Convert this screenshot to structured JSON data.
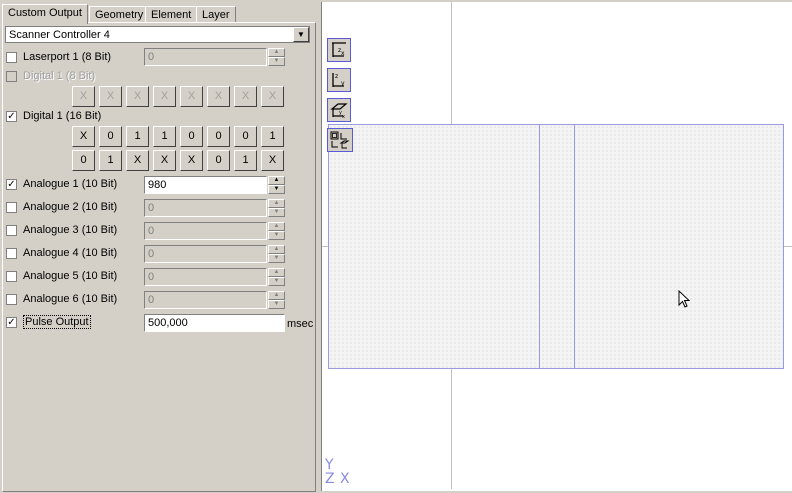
{
  "tabs": [
    "Custom Output",
    "Geometry",
    "Element",
    "Layer"
  ],
  "controller": "Scanner Controller 4",
  "rows": {
    "laserport": {
      "label": "Laserport 1 (8 Bit)",
      "checked": false,
      "value": "0"
    },
    "digital8": {
      "label": "Digital 1 (8 Bit)",
      "checked": false
    },
    "digital16": {
      "label": "Digital 1 (16 Bit)",
      "checked": true
    },
    "analogue1": {
      "label": "Analogue 1 (10 Bit)",
      "checked": true,
      "value": "980"
    },
    "analogue2": {
      "label": "Analogue 2 (10 Bit)",
      "checked": false,
      "value": "0"
    },
    "analogue3": {
      "label": "Analogue 3 (10 Bit)",
      "checked": false,
      "value": "0"
    },
    "analogue4": {
      "label": "Analogue 4 (10 Bit)",
      "checked": false,
      "value": "0"
    },
    "analogue5": {
      "label": "Analogue 5 (10 Bit)",
      "checked": false,
      "value": "0"
    },
    "analogue6": {
      "label": "Analogue 6 (10 Bit)",
      "checked": false,
      "value": "0"
    },
    "pulse": {
      "label": "Pulse Output",
      "checked": true,
      "value": "500,000",
      "unit": "msec"
    }
  },
  "bits8": [
    "X",
    "X",
    "X",
    "X",
    "X",
    "X",
    "X",
    "X"
  ],
  "bits16_row1": [
    "X",
    "0",
    "1",
    "1",
    "0",
    "0",
    "0",
    "1"
  ],
  "bits16_row2": [
    "0",
    "1",
    "X",
    "X",
    "X",
    "0",
    "1",
    "X"
  ],
  "axis_labels": {
    "y": "Y",
    "z": "Z",
    "x": "X"
  },
  "check_mark": "✓"
}
